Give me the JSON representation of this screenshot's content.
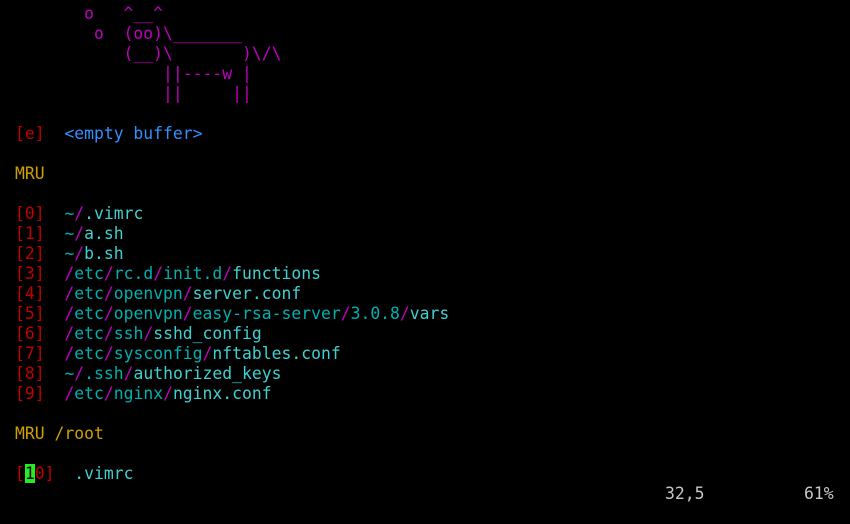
{
  "colors": {
    "background": "#000000",
    "cow": "#c000c0",
    "index_bracket": "#c00000",
    "path_directory": "#00b0b0",
    "path_filename": "#40d0d0",
    "path_separator": "#c000c0",
    "header": "#d0a000",
    "special_entry": "#3090ff",
    "cursor": "#22ee22"
  },
  "cowsay": [
    "       o   ^__^",
    "        o  (oo)\\_______",
    "           (__)\\       )\\/\\",
    "               ||----w |",
    "               ||     ||"
  ],
  "empty_buffer": {
    "key": "[e]",
    "label": "<empty buffer>"
  },
  "mru_header": "MRU",
  "mru_entries": [
    {
      "key": "[0]",
      "parts": [
        {
          "t": "~",
          "c": "dir"
        },
        {
          "t": "/",
          "c": "sep"
        },
        {
          "t": ".vimrc",
          "c": "fname"
        }
      ]
    },
    {
      "key": "[1]",
      "parts": [
        {
          "t": "~",
          "c": "dir"
        },
        {
          "t": "/",
          "c": "sep"
        },
        {
          "t": "a.sh",
          "c": "fname"
        }
      ]
    },
    {
      "key": "[2]",
      "parts": [
        {
          "t": "~",
          "c": "dir"
        },
        {
          "t": "/",
          "c": "sep"
        },
        {
          "t": "b.sh",
          "c": "fname"
        }
      ]
    },
    {
      "key": "[3]",
      "parts": [
        {
          "t": "/",
          "c": "sep"
        },
        {
          "t": "etc",
          "c": "dir"
        },
        {
          "t": "/",
          "c": "sep"
        },
        {
          "t": "rc.d",
          "c": "dir"
        },
        {
          "t": "/",
          "c": "sep"
        },
        {
          "t": "init.d",
          "c": "dir"
        },
        {
          "t": "/",
          "c": "sep"
        },
        {
          "t": "functions",
          "c": "fname"
        }
      ]
    },
    {
      "key": "[4]",
      "parts": [
        {
          "t": "/",
          "c": "sep"
        },
        {
          "t": "etc",
          "c": "dir"
        },
        {
          "t": "/",
          "c": "sep"
        },
        {
          "t": "openvpn",
          "c": "dir"
        },
        {
          "t": "/",
          "c": "sep"
        },
        {
          "t": "server.conf",
          "c": "fname"
        }
      ]
    },
    {
      "key": "[5]",
      "parts": [
        {
          "t": "/",
          "c": "sep"
        },
        {
          "t": "etc",
          "c": "dir"
        },
        {
          "t": "/",
          "c": "sep"
        },
        {
          "t": "openvpn",
          "c": "dir"
        },
        {
          "t": "/",
          "c": "sep"
        },
        {
          "t": "easy-rsa-server",
          "c": "dir"
        },
        {
          "t": "/",
          "c": "sep"
        },
        {
          "t": "3.0.8",
          "c": "dir"
        },
        {
          "t": "/",
          "c": "sep"
        },
        {
          "t": "vars",
          "c": "fname"
        }
      ]
    },
    {
      "key": "[6]",
      "parts": [
        {
          "t": "/",
          "c": "sep"
        },
        {
          "t": "etc",
          "c": "dir"
        },
        {
          "t": "/",
          "c": "sep"
        },
        {
          "t": "ssh",
          "c": "dir"
        },
        {
          "t": "/",
          "c": "sep"
        },
        {
          "t": "sshd_config",
          "c": "fname"
        }
      ]
    },
    {
      "key": "[7]",
      "parts": [
        {
          "t": "/",
          "c": "sep"
        },
        {
          "t": "etc",
          "c": "dir"
        },
        {
          "t": "/",
          "c": "sep"
        },
        {
          "t": "sysconfig",
          "c": "dir"
        },
        {
          "t": "/",
          "c": "sep"
        },
        {
          "t": "nftables.conf",
          "c": "fname"
        }
      ]
    },
    {
      "key": "[8]",
      "parts": [
        {
          "t": "~",
          "c": "dir"
        },
        {
          "t": "/",
          "c": "sep"
        },
        {
          "t": ".ssh",
          "c": "dir"
        },
        {
          "t": "/",
          "c": "sep"
        },
        {
          "t": "authorized_keys",
          "c": "fname"
        }
      ]
    },
    {
      "key": "[9]",
      "parts": [
        {
          "t": "/",
          "c": "sep"
        },
        {
          "t": "etc",
          "c": "dir"
        },
        {
          "t": "/",
          "c": "sep"
        },
        {
          "t": "nginx",
          "c": "dir"
        },
        {
          "t": "/",
          "c": "sep"
        },
        {
          "t": "nginx.conf",
          "c": "fname"
        }
      ]
    }
  ],
  "mru_cwd_header": "MRU /root",
  "cwd_entry": {
    "key_open": "[",
    "key_cursor_char": "1",
    "key_rest": "0]",
    "file": ".vimrc"
  },
  "status": {
    "position": "32,5",
    "percent": "61%"
  }
}
